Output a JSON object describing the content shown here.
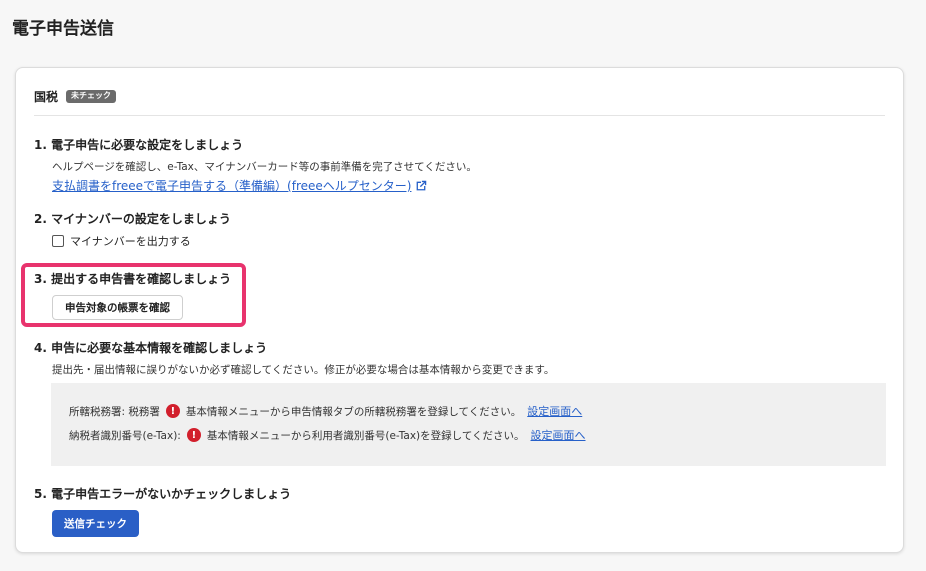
{
  "page": {
    "title": "電子申告送信"
  },
  "card": {
    "header_label": "国税",
    "badge": "未チェック"
  },
  "steps": [
    {
      "title": "1. 電子申告に必要な設定をしましょう",
      "desc": "ヘルプページを確認し、e-Tax、マイナンバーカード等の事前準備を完了させてください。",
      "link": "支払調書をfreeeで電子申告する（準備編）(freeeヘルプセンター)"
    },
    {
      "title": "2. マイナンバーの設定をしましょう",
      "checkbox_label": "マイナンバーを出力する"
    },
    {
      "title": "3. 提出する申告書を確認しましょう",
      "button": "申告対象の帳票を確認"
    },
    {
      "title": "4. 申告に必要な基本情報を確認しましょう",
      "desc": "提出先・届出情報に誤りがないか必ず確認してください。修正が必要な場合は基本情報から変更できます。",
      "rows": [
        {
          "label": "所轄税務署: 税務署",
          "message": "基本情報メニューから申告情報タブの所轄税務署を登録してください。",
          "link": "設定画面へ"
        },
        {
          "label": "納税者識別番号(e-Tax):",
          "message": "基本情報メニューから利用者識別番号(e-Tax)を登録してください。",
          "link": "設定画面へ"
        }
      ]
    },
    {
      "title": "5. 電子申告エラーがないかチェックしましょう",
      "button": "送信チェック"
    }
  ],
  "colors": {
    "primary": "#2a5fc6",
    "link": "#2660c9",
    "highlight": "#e8336d",
    "warning": "#d21f2c"
  },
  "icons": {
    "external_link": "external-link-icon",
    "warning": "exclamation-circle-icon"
  }
}
